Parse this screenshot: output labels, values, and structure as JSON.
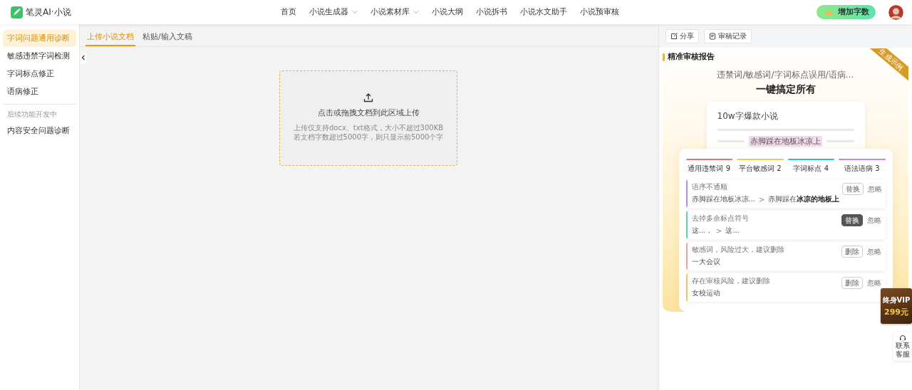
{
  "header": {
    "logo": "笔灵AI·小说",
    "nav": [
      {
        "label": "首页",
        "dropdown": false
      },
      {
        "label": "小说生成器",
        "dropdown": true
      },
      {
        "label": "小说素材库",
        "dropdown": true
      },
      {
        "label": "小说大纲",
        "dropdown": false
      },
      {
        "label": "小说拆书",
        "dropdown": false
      },
      {
        "label": "小说水文助手",
        "dropdown": false
      },
      {
        "label": "小说预审核",
        "dropdown": false
      }
    ],
    "add_words_button": "增加字数"
  },
  "sidebar": {
    "items": [
      {
        "label": "字词问题通用诊断",
        "selected": true
      },
      {
        "label": "敏感违禁字词检测",
        "selected": false
      },
      {
        "label": "字词标点修正",
        "selected": false
      },
      {
        "label": "语病修正",
        "selected": false
      }
    ],
    "section_label": "后续功能开发中",
    "later_items": [
      {
        "label": "内容安全问题诊断",
        "selected": false
      }
    ]
  },
  "editor": {
    "tabs": [
      {
        "label": "上传小说文档",
        "selected": true
      },
      {
        "label": "粘贴/输入文稿",
        "selected": false
      }
    ],
    "upload": {
      "title": "点击或拖拽文档到此区域上传",
      "hints": [
        "上传仅支持docx、txt格式，大小不超过300KB",
        "若文档字数超过5000字，则只显示前5000个字"
      ]
    }
  },
  "report": {
    "toolbar": [
      {
        "label": "分享",
        "kind": "share"
      },
      {
        "label": "审稿记录",
        "kind": "history"
      }
    ],
    "title": "精准审核报告",
    "ribbon": "生成示例",
    "subtitle": "违禁词/敏感词/字词标点误用/语病…",
    "headline": "一键搞定所有",
    "sample_title": "10w字爆款小说",
    "sample_highlight": "赤脚踩在地板冰凉上",
    "categories": [
      {
        "label": "通用违禁词 9",
        "color": "#f07070"
      },
      {
        "label": "平台敏感词 2",
        "color": "#f5c453"
      },
      {
        "label": "字词标点 4",
        "color": "#22c3d8"
      },
      {
        "label": "语法语病 3",
        "color": "#c084fc"
      }
    ],
    "issues": [
      {
        "type": "语序不通顺",
        "original": "赤脚踩在地板冰凉...",
        "arrow": ">",
        "suggestion": "赤脚踩在**冰凉的地板上**",
        "action": "替换",
        "active": false,
        "ignore": "忽略",
        "color": "#c084fc"
      },
      {
        "type": "去掉多余标点符号",
        "original": "这...，",
        "arrow": ">",
        "suggestion": "这...",
        "action": "替换",
        "active": true,
        "ignore": "忽略",
        "color": "#5fd3a8"
      },
      {
        "type": "敏感词，风险过大，建议删除",
        "original": "一大会议",
        "action": "删除",
        "active": false,
        "ignore": "忽略",
        "color": "#f8a0a0"
      },
      {
        "type": "存在审核风险，建议删除",
        "original": "女校运动",
        "action": "删除",
        "active": false,
        "ignore": "忽略",
        "color": "#f5c453"
      }
    ]
  },
  "vip_badge": {
    "line1": "终身VIP",
    "line2": "299元"
  },
  "contact": {
    "line1": "联系",
    "line2": "客服"
  }
}
